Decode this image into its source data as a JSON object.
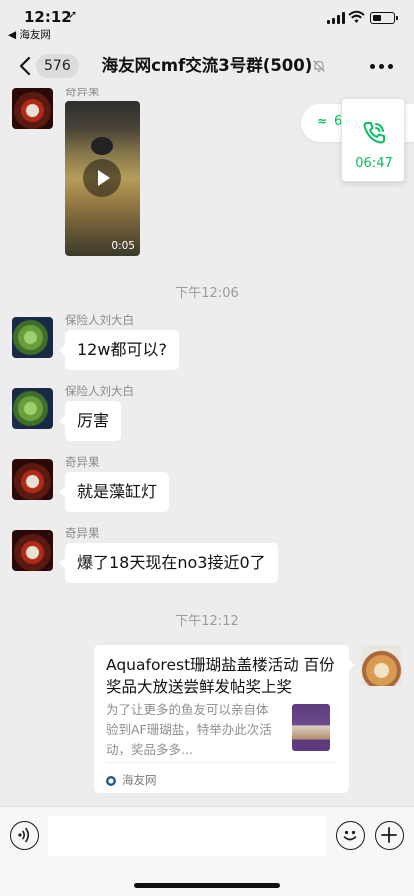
{
  "status_bar": {
    "time": "12:12",
    "location_arrow": "➚",
    "back_app": "◀ 海友网"
  },
  "nav": {
    "unread_count": "576",
    "title": "海友网cmf交流3号群(500)",
    "icons": [
      "back-chevron-icon",
      "mute-bell-icon",
      "more-dots-icon"
    ]
  },
  "floating": {
    "pill_chevron": "≈",
    "pill_partial_text": "6",
    "call_time": "06:47"
  },
  "messages": [
    {
      "type": "video",
      "sender": "奇异果",
      "duration": "0:05"
    },
    {
      "type": "time",
      "text": "下午12:06"
    },
    {
      "type": "text",
      "sender": "保险人刘大白",
      "text": "12w都可以?"
    },
    {
      "type": "text",
      "sender": "保险人刘大白",
      "text": "厉害"
    },
    {
      "type": "text",
      "sender": "奇异果",
      "text": "就是藻缸灯"
    },
    {
      "type": "text",
      "sender": "奇异果",
      "text": "爆了18天现在no3接近0了"
    },
    {
      "type": "time",
      "text": "下午12:12"
    },
    {
      "type": "link",
      "title": "Aquaforest珊瑚盐盖楼活动 百份奖品大放送尝鲜发帖奖上奖",
      "description": "为了让更多的鱼友可以亲自体验到AF珊瑚盐，特举办此次活动，奖品多多...",
      "source": "海友网"
    }
  ],
  "input": {
    "placeholder": ""
  },
  "colors": {
    "accent_green": "#07c160",
    "chat_background": "#ededed"
  }
}
